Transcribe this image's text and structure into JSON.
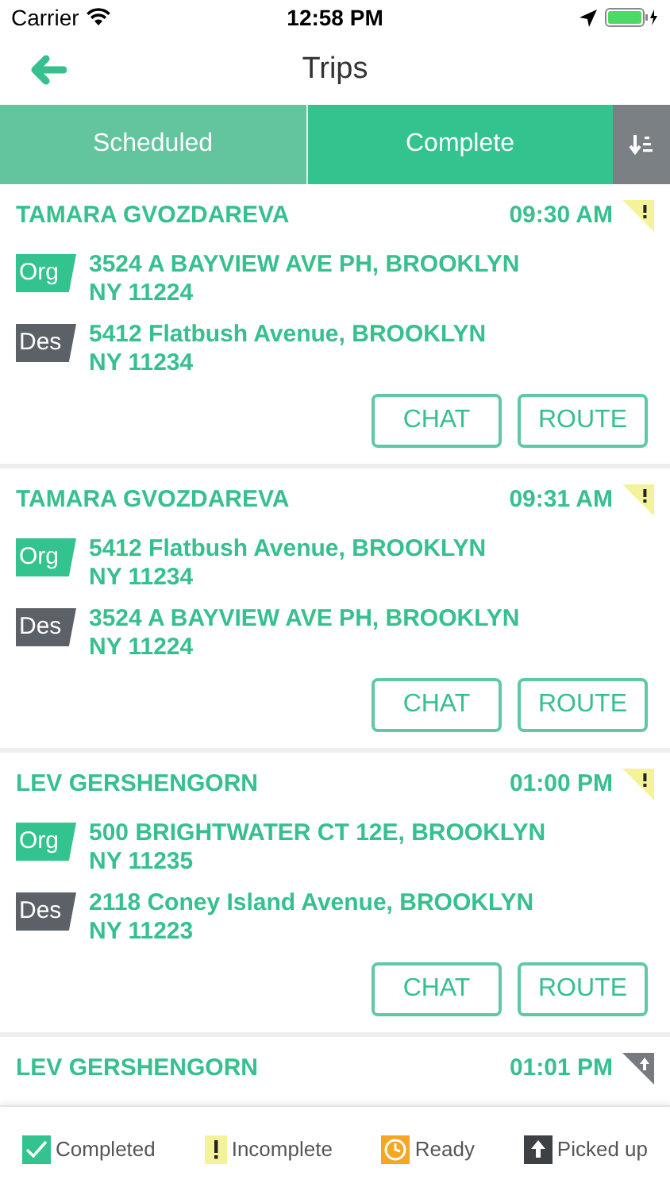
{
  "status_bar": {
    "carrier": "Carrier",
    "time": "12:58 PM"
  },
  "nav": {
    "title": "Trips"
  },
  "tabs": [
    {
      "label": "Scheduled",
      "selected": false
    },
    {
      "label": "Complete",
      "selected": true
    }
  ],
  "trips": [
    {
      "name": "TAMARA GVOZDAREVA",
      "time": "09:30 AM",
      "kind": "incomplete",
      "origin": [
        "3524 A BAYVIEW AVE PH, BROOKLYN",
        "NY 11224"
      ],
      "destination": [
        "5412 Flatbush Avenue, BROOKLYN",
        "NY 11234"
      ],
      "origin_tag": "Org",
      "destination_tag": "Des",
      "buttons": [
        "CHAT",
        "ROUTE"
      ]
    },
    {
      "name": "TAMARA GVOZDAREVA",
      "time": "09:31 AM",
      "kind": "incomplete",
      "origin": [
        "5412 Flatbush Avenue, BROOKLYN",
        "NY 11234"
      ],
      "destination": [
        "3524 A BAYVIEW AVE PH, BROOKLYN",
        "NY 11224"
      ],
      "origin_tag": "Org",
      "destination_tag": "Des",
      "buttons": [
        "CHAT",
        "ROUTE"
      ]
    },
    {
      "name": "LEV GERSHENGORN",
      "time": "01:00 PM",
      "kind": "incomplete",
      "origin": [
        "500 BRIGHTWATER CT 12E, BROOKLYN",
        "NY 11235"
      ],
      "destination": [
        "2118 Coney Island Avenue, BROOKLYN",
        "NY 11223"
      ],
      "origin_tag": "Org",
      "destination_tag": "Des",
      "buttons": [
        "CHAT",
        "ROUTE"
      ]
    },
    {
      "name": "LEV GERSHENGORN",
      "time": "01:01 PM",
      "kind": "picked_up"
    }
  ],
  "legend": [
    {
      "kind": "completed",
      "label": "Completed"
    },
    {
      "kind": "incomplete",
      "label": "Incomplete"
    },
    {
      "kind": "ready",
      "label": "Ready"
    },
    {
      "kind": "picked_up",
      "label": "Picked up"
    }
  ]
}
